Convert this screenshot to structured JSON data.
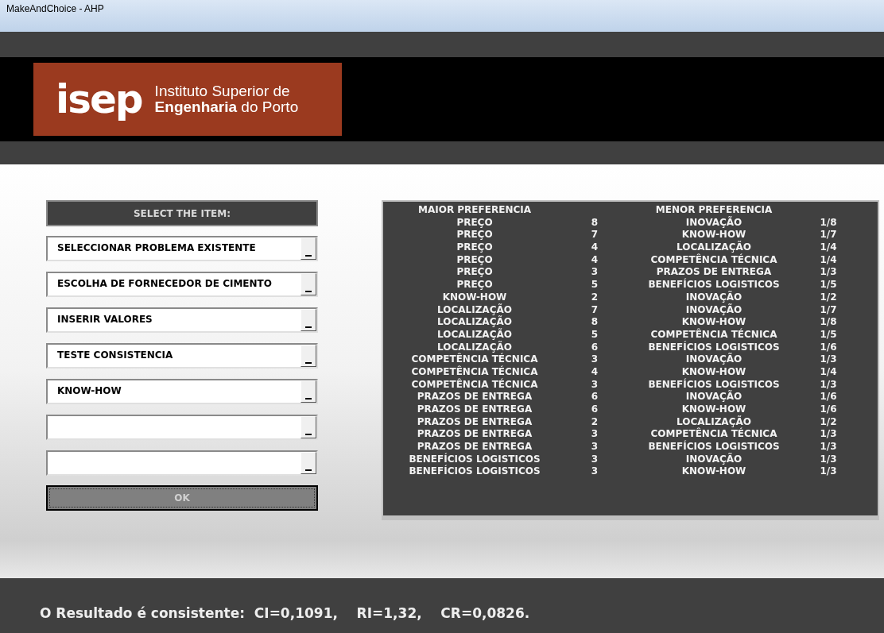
{
  "window": {
    "title": "MakeAndChoice - AHP"
  },
  "logo": {
    "mark": "isep",
    "line_1": "Instituto Superior de",
    "line_2": "**Engenharia** do Porto"
  },
  "selector": {
    "header": "SELECT THE ITEM:",
    "fields": [
      {
        "kind": "filled",
        "value": "SELECCIONAR PROBLEMA EXISTENTE"
      },
      {
        "kind": "filled",
        "value": "ESCOLHA DE FORNECEDOR DE CIMENTO"
      },
      {
        "kind": "filled",
        "value": "INSERIR VALORES"
      },
      {
        "kind": "filled",
        "value": "TESTE CONSISTENCIA"
      },
      {
        "kind": "filled",
        "value": "KNOW-HOW"
      },
      {
        "kind": "empty"
      },
      {
        "kind": "empty"
      }
    ],
    "ok_button": "OK"
  },
  "comparisons": {
    "column_1": "MAIOR PREFERENCIA",
    "column_3": "MENOR PREFERENCIA",
    "rows": [
      {
        "higher": "PREÇO",
        "score": "8",
        "lower": "INOVAÇÃO",
        "reciprocal": "1/8"
      },
      {
        "higher": "PREÇO",
        "score": "7",
        "lower": "KNOW-HOW",
        "reciprocal": "1/7"
      },
      {
        "higher": "PREÇO",
        "score": "4",
        "lower": "LOCALIZAÇÃO",
        "reciprocal": "1/4"
      },
      {
        "higher": "PREÇO",
        "score": "4",
        "lower": "COMPETÊNCIA TÉCNICA",
        "reciprocal": "1/4"
      },
      {
        "higher": "PREÇO",
        "score": "3",
        "lower": "PRAZOS DE ENTREGA",
        "reciprocal": "1/3"
      },
      {
        "higher": "PREÇO",
        "score": "5",
        "lower": "BENEFÍCIOS LOGISTICOS",
        "reciprocal": "1/5"
      },
      {
        "higher": "KNOW-HOW",
        "score": "2",
        "lower": "INOVAÇÃO",
        "reciprocal": "1/2"
      },
      {
        "higher": "LOCALIZAÇÃO",
        "score": "7",
        "lower": "INOVAÇÃO",
        "reciprocal": "1/7"
      },
      {
        "higher": "LOCALIZAÇÃO",
        "score": "8",
        "lower": "KNOW-HOW",
        "reciprocal": "1/8"
      },
      {
        "higher": "LOCALIZAÇÃO",
        "score": "5",
        "lower": "COMPETÊNCIA TÉCNICA",
        "reciprocal": "1/5"
      },
      {
        "higher": "LOCALIZAÇÃO",
        "score": "6",
        "lower": "BENEFÍCIOS LOGISTICOS",
        "reciprocal": "1/6"
      },
      {
        "higher": "COMPETÊNCIA TÉCNICA",
        "score": "3",
        "lower": "INOVAÇÃO",
        "reciprocal": "1/3"
      },
      {
        "higher": "COMPETÊNCIA TÉCNICA",
        "score": "4",
        "lower": "KNOW-HOW",
        "reciprocal": "1/4"
      },
      {
        "higher": "COMPETÊNCIA TÉCNICA",
        "score": "3",
        "lower": "BENEFÍCIOS LOGISTICOS",
        "reciprocal": "1/3"
      },
      {
        "higher": "PRAZOS DE ENTREGA",
        "score": "6",
        "lower": "INOVAÇÃO",
        "reciprocal": "1/6"
      },
      {
        "higher": "PRAZOS DE ENTREGA",
        "score": "6",
        "lower": "KNOW-HOW",
        "reciprocal": "1/6"
      },
      {
        "higher": "PRAZOS DE ENTREGA",
        "score": "2",
        "lower": "LOCALIZAÇÃO",
        "reciprocal": "1/2"
      },
      {
        "higher": "PRAZOS DE ENTREGA",
        "score": "3",
        "lower": "COMPETÊNCIA TÉCNICA",
        "reciprocal": "1/3"
      },
      {
        "higher": "PRAZOS DE ENTREGA",
        "score": "3",
        "lower": "BENEFÍCIOS LOGISTICOS",
        "reciprocal": "1/3"
      },
      {
        "higher": "BENEFÍCIOS LOGISTICOS",
        "score": "3",
        "lower": "INOVAÇÃO",
        "reciprocal": "1/3"
      },
      {
        "higher": "BENEFÍCIOS LOGISTICOS",
        "score": "3",
        "lower": "KNOW-HOW",
        "reciprocal": "1/3"
      }
    ]
  },
  "status_bar": "O Resultado é consistente:  CI=0,1091,    RI=1,32,    CR=0,0826."
}
